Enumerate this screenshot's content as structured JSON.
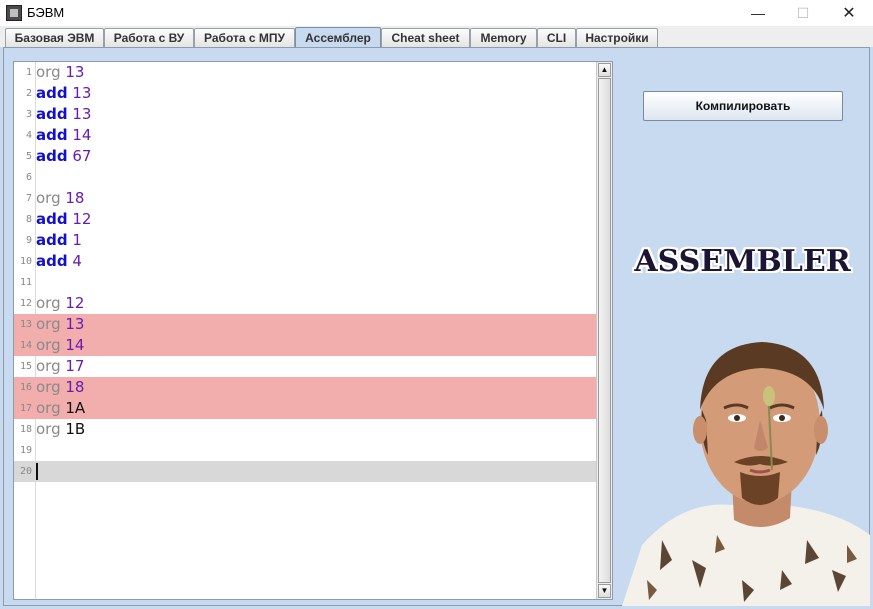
{
  "window": {
    "title": "БЭВМ",
    "min_glyph": "—",
    "max_glyph": "☐",
    "close_glyph": "✕"
  },
  "tabs": [
    {
      "label": "Базовая ЭВМ",
      "active": false
    },
    {
      "label": "Работа с ВУ",
      "active": false
    },
    {
      "label": "Работа с МПУ",
      "active": false
    },
    {
      "label": "Ассемблер",
      "active": true
    },
    {
      "label": "Cheat sheet",
      "active": false
    },
    {
      "label": "Memory",
      "active": false
    },
    {
      "label": "CLI",
      "active": false
    },
    {
      "label": "Настройки",
      "active": false
    }
  ],
  "editor": {
    "lines": [
      {
        "n": "1",
        "op": "org",
        "arg": "13",
        "hl": false
      },
      {
        "n": "2",
        "op": "add",
        "arg": "13",
        "hl": false
      },
      {
        "n": "3",
        "op": "add",
        "arg": "13",
        "hl": false
      },
      {
        "n": "4",
        "op": "add",
        "arg": "14",
        "hl": false
      },
      {
        "n": "5",
        "op": "add",
        "arg": "67",
        "hl": false
      },
      {
        "n": "6",
        "op": "",
        "arg": "",
        "hl": false
      },
      {
        "n": "7",
        "op": "org",
        "arg": "18",
        "hl": false
      },
      {
        "n": "8",
        "op": "add",
        "arg": "12",
        "hl": false
      },
      {
        "n": "9",
        "op": "add",
        "arg": "1",
        "hl": false
      },
      {
        "n": "10",
        "op": "add",
        "arg": "4",
        "hl": false
      },
      {
        "n": "11",
        "op": "",
        "arg": "",
        "hl": false
      },
      {
        "n": "12",
        "op": "org",
        "arg": "12",
        "hl": false
      },
      {
        "n": "13",
        "op": "org",
        "arg": "13",
        "hl": true
      },
      {
        "n": "14",
        "op": "org",
        "arg": "14",
        "hl": true
      },
      {
        "n": "15",
        "op": "org",
        "arg": "17",
        "hl": false
      },
      {
        "n": "16",
        "op": "org",
        "arg": "18",
        "hl": true
      },
      {
        "n": "17",
        "op": "org",
        "arg": "1A",
        "hl": true
      },
      {
        "n": "18",
        "op": "org",
        "arg": "1B",
        "hl": false
      },
      {
        "n": "19",
        "op": "",
        "arg": "",
        "hl": false
      },
      {
        "n": "20",
        "op": "",
        "arg": "",
        "hl": false,
        "current": true
      }
    ],
    "scroll_up_glyph": "▲",
    "scroll_down_glyph": "▼"
  },
  "compile_button": {
    "label": "Компилировать"
  },
  "logo": {
    "text": "ASSEMBLER"
  },
  "colors": {
    "panel_bg": "#c7daef",
    "error_highlight": "#f2adad",
    "current_line": "#d8d8d8",
    "keyword_add": "#1111cc",
    "keyword_org": "#8a8a8a",
    "number": "#6a1bb0"
  },
  "photo": {
    "icon": "portrait-photo"
  }
}
